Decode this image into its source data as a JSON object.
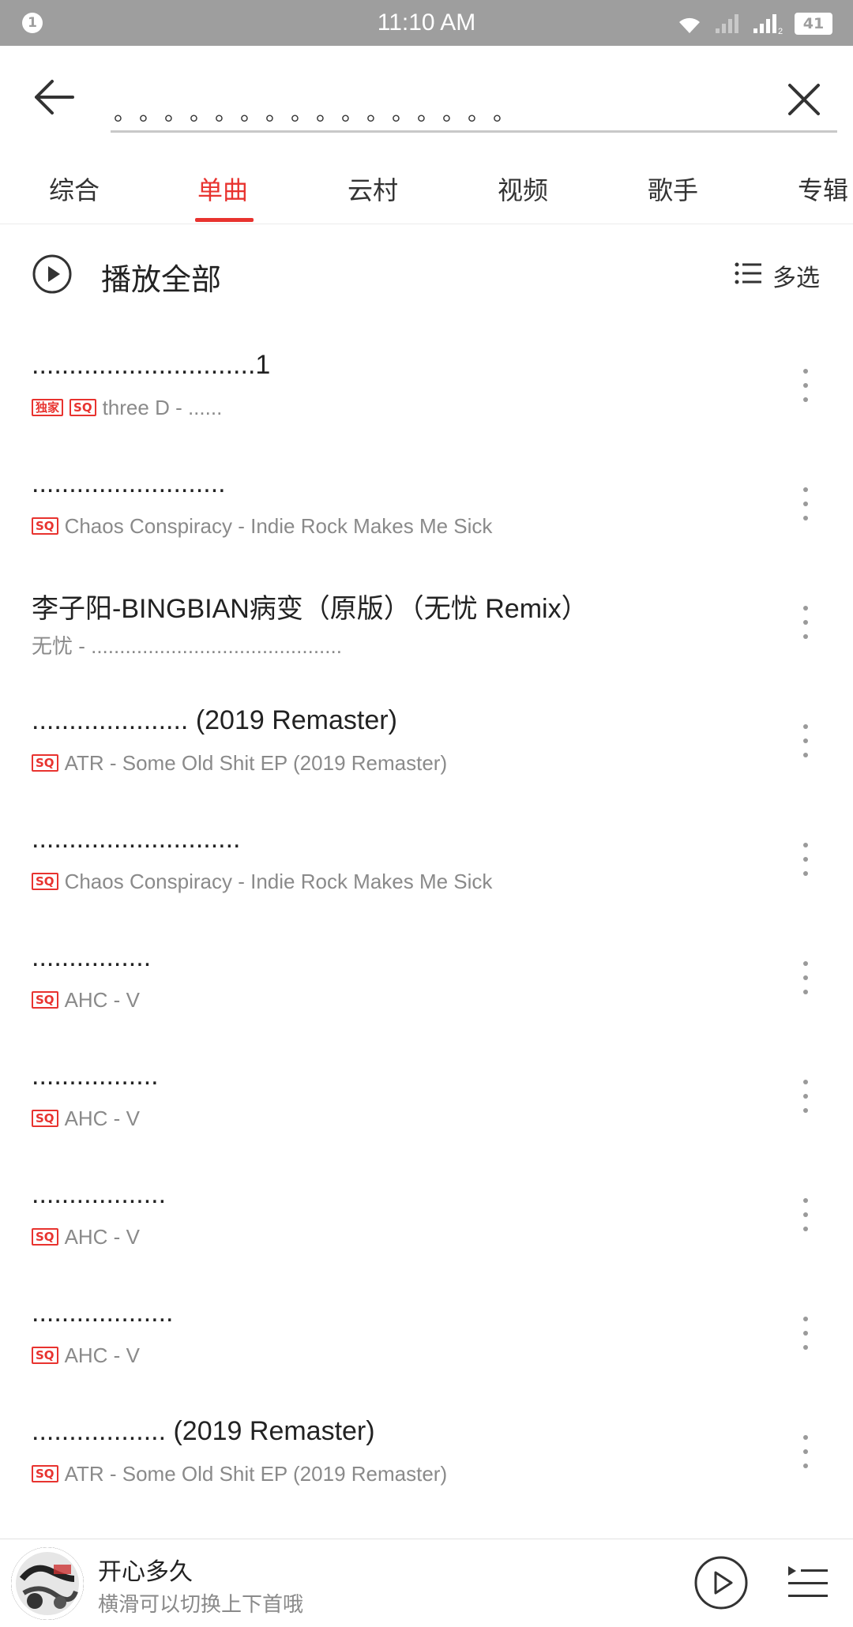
{
  "status_bar": {
    "notification_count": "1",
    "time": "11:10 AM",
    "battery": "41",
    "sim_index": "2",
    "icons": [
      "wifi-icon",
      "signal-icon",
      "signal-icon",
      "battery-icon"
    ]
  },
  "search": {
    "query": "。。。。。。。。。。。。。。。。",
    "back_icon": "arrow-left-icon",
    "clear_icon": "close-icon"
  },
  "tabs": [
    {
      "label": "综合",
      "active": false
    },
    {
      "label": "单曲",
      "active": true
    },
    {
      "label": "云村",
      "active": false
    },
    {
      "label": "视频",
      "active": false
    },
    {
      "label": "歌手",
      "active": false
    },
    {
      "label": "专辑",
      "active": false
    }
  ],
  "toolbar": {
    "play_all_label": "播放全部",
    "multi_select_label": "多选"
  },
  "songs": [
    {
      "title": "..............................1",
      "badges": [
        "独家",
        "SQ"
      ],
      "subtitle": "three D - ......"
    },
    {
      "title": "..........................",
      "badges": [
        "SQ"
      ],
      "subtitle": "Chaos Conspiracy - Indie Rock Makes Me Sick"
    },
    {
      "title": "李子阳-BINGBIAN病变（原版）（无忧 Remix）",
      "badges": [],
      "subtitle": "无忧 - ............................................"
    },
    {
      "title": "..................... (2019 Remaster)",
      "badges": [
        "SQ"
      ],
      "subtitle": "ATR - Some Old Shit EP (2019 Remaster)"
    },
    {
      "title": "............................",
      "badges": [
        "SQ"
      ],
      "subtitle": "Chaos Conspiracy - Indie Rock Makes Me Sick"
    },
    {
      "title": "................",
      "badges": [
        "SQ"
      ],
      "subtitle": "AHC - V"
    },
    {
      "title": ".................",
      "badges": [
        "SQ"
      ],
      "subtitle": "AHC - V"
    },
    {
      "title": "..................",
      "badges": [
        "SQ"
      ],
      "subtitle": "AHC - V"
    },
    {
      "title": "...................",
      "badges": [
        "SQ"
      ],
      "subtitle": "AHC - V"
    },
    {
      "title": ".................. (2019 Remaster)",
      "badges": [
        "SQ"
      ],
      "subtitle": "ATR - Some Old Shit EP (2019 Remaster)"
    }
  ],
  "mini_player": {
    "title": "开心多久",
    "subtitle": "横滑可以切换上下首哦",
    "play_icon": "play-circle-icon",
    "playlist_icon": "playlist-icon"
  },
  "colors": {
    "accent": "#e8332f",
    "status_bar": "#9e9e9e",
    "text_primary": "#222222",
    "text_secondary": "#8a8a8a"
  }
}
